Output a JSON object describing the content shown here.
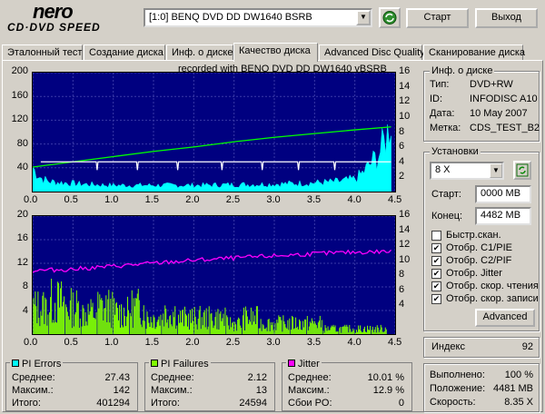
{
  "header": {
    "logo_top": "nero",
    "logo_bottom": "CD·DVD SPEED",
    "drive": "[1:0]   BENQ DVD DD DW1640 BSRB",
    "start_label": "Старт",
    "exit_label": "Выход"
  },
  "tabs": [
    {
      "label": "Эталонный тест"
    },
    {
      "label": "Создание диска"
    },
    {
      "label": "Инф. о диске"
    },
    {
      "label": "Качество диска"
    },
    {
      "label": "Advanced Disc Quality"
    },
    {
      "label": "Сканирование диска"
    }
  ],
  "active_tab": "Качество диска",
  "recorded_with": "recorded with BENQ    DVD DD DW1640    vBSRB",
  "disc_info": {
    "title": "Инф. о диске",
    "type_label": "Тип:",
    "type_value": "DVD+RW",
    "id_label": "ID:",
    "id_value": "INFODISC A10",
    "date_label": "Дата:",
    "date_value": "10 May 2007",
    "mark_label": "Метка:",
    "mark_value": "CDS_TEST_B2"
  },
  "settings": {
    "title": "Установки",
    "speed": "8 X",
    "start_label": "Старт:",
    "start_value": "0000 MB",
    "end_label": "Конец:",
    "end_value": "4482 MB",
    "options": [
      {
        "label": "Быстр.скан.",
        "checked": false
      },
      {
        "label": "Отобр. C1/PIE",
        "checked": true
      },
      {
        "label": "Отобр. C2/PIF",
        "checked": true
      },
      {
        "label": "Отобр. Jitter",
        "checked": true
      },
      {
        "label": "Отобр. скор. чтения",
        "checked": true
      },
      {
        "label": "Отобр. скор. записи",
        "checked": true
      }
    ],
    "advanced_label": "Advanced"
  },
  "index": {
    "label": "Индекс",
    "value": "92"
  },
  "progress": {
    "done_label": "Выполнено:",
    "done_value": "100 %",
    "pos_label": "Положение:",
    "pos_value": "4481 MB",
    "speed_label": "Скорость:",
    "speed_value": "8.35 X"
  },
  "pi_errors": {
    "title": "PI Errors",
    "color": "#00ffff",
    "avg_label": "Среднее:",
    "avg": "27.43",
    "max_label": "Максим.:",
    "max": "142",
    "total_label": "Итого:",
    "total": "401294"
  },
  "pi_failures": {
    "title": "PI Failures",
    "color": "#80ff00",
    "avg_label": "Среднее:",
    "avg": "2.12",
    "max_label": "Максим.:",
    "max": "13",
    "total_label": "Итого:",
    "total": "24594"
  },
  "jitter": {
    "title": "Jitter",
    "color": "#ff00ff",
    "avg_label": "Среднее:",
    "avg": "10.01 %",
    "max_label": "Максим.:",
    "max": "12.9 %",
    "po_label": "Сбои PO:",
    "po": "0"
  },
  "chart_data": [
    {
      "type": "area",
      "name": "pi-errors-chart",
      "x_ticks": [
        "0.0",
        "0.5",
        "1.0",
        "1.5",
        "2.0",
        "2.5",
        "3.0",
        "3.5",
        "4.0",
        "4.5"
      ],
      "y_left_ticks": [
        "200",
        "160",
        "120",
        "80",
        "40"
      ],
      "y_right_ticks": [
        "16",
        "14",
        "12",
        "10",
        "8",
        "6",
        "4",
        "2"
      ],
      "xlim": [
        0,
        4.5
      ],
      "ylim": [
        0,
        200
      ],
      "y2lim": [
        0,
        16
      ],
      "series": [
        {
          "color": "#00ffff",
          "x": [
            0,
            0.1,
            0.2,
            0.4,
            0.6,
            0.8,
            1.0,
            1.5,
            2.0,
            2.5,
            3.0,
            3.5,
            3.8,
            4.0,
            4.1,
            4.2,
            4.3,
            4.4,
            4.45
          ],
          "y": [
            38,
            22,
            16,
            14,
            12,
            11,
            10,
            10,
            10,
            11,
            12,
            14,
            16,
            20,
            30,
            45,
            60,
            90,
            120
          ]
        },
        {
          "color": "#00ff00",
          "x": [
            0,
            0.5,
            1.0,
            1.5,
            2.0,
            2.5,
            3.0,
            3.5,
            4.0,
            4.45
          ],
          "y": [
            3.3,
            4.0,
            4.7,
            5.4,
            6.0,
            6.7,
            7.3,
            7.8,
            8.3,
            8.7
          ]
        },
        {
          "color": "#ffffff",
          "x": [
            0.1,
            4.45
          ],
          "y": [
            4.0,
            4.0
          ]
        }
      ],
      "dips_x": [
        0.8,
        1.3,
        1.8,
        2.35,
        2.85,
        3.3,
        3.75
      ]
    },
    {
      "type": "bar",
      "name": "pi-failures-chart",
      "x_ticks": [
        "0.0",
        "0.5",
        "1.0",
        "1.5",
        "2.0",
        "2.5",
        "3.0",
        "3.5",
        "4.0",
        "4.5"
      ],
      "y_left_ticks": [
        "20",
        "16",
        "12",
        "8",
        "4"
      ],
      "y_right_ticks": [
        "16",
        "14",
        "12",
        "10",
        "8",
        "6",
        "4"
      ],
      "xlim": [
        0,
        4.5
      ],
      "ylim": [
        0,
        20
      ],
      "y2lim": [
        0,
        16
      ],
      "series": [
        {
          "color": "#80ff00",
          "x": [
            0.1,
            0.3,
            0.5,
            0.7,
            0.9,
            1.1,
            1.3,
            1.5,
            1.7,
            1.9,
            2.1,
            2.3,
            2.5,
            2.7,
            2.9,
            3.1,
            3.3,
            3.5,
            3.7,
            3.9,
            4.1,
            4.3
          ],
          "y": [
            5,
            6,
            5,
            4,
            5,
            4,
            5,
            3,
            4,
            3,
            3,
            3,
            2,
            3,
            2,
            2,
            2,
            2,
            1,
            1,
            1,
            1
          ]
        },
        {
          "color": "#ff00ff",
          "x": [
            0,
            0.5,
            1.0,
            1.5,
            2.0,
            2.5,
            3.0,
            3.5,
            4.0,
            4.45
          ],
          "y": [
            8.6,
            8.8,
            9.2,
            9.6,
            10.0,
            10.3,
            10.6,
            10.9,
            11.1,
            11.2
          ]
        }
      ]
    }
  ]
}
